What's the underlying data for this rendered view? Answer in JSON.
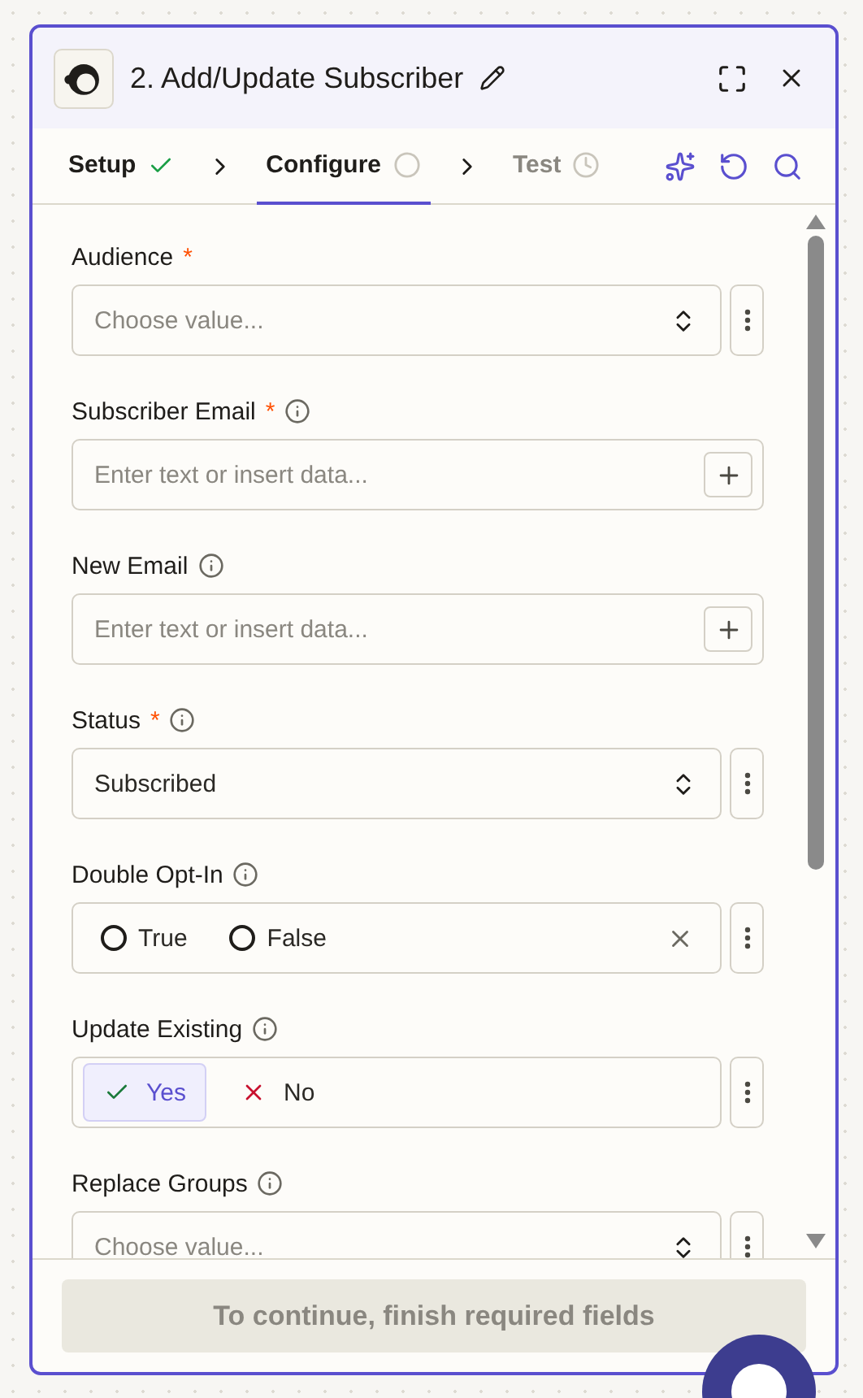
{
  "header": {
    "title": "2. Add/Update Subscriber"
  },
  "tabs": [
    {
      "label": "Setup",
      "selected": false,
      "done": true,
      "disabled": false
    },
    {
      "label": "Configure",
      "selected": true,
      "done": false,
      "disabled": false
    },
    {
      "label": "Test",
      "selected": false,
      "done": false,
      "disabled": true
    }
  ],
  "fields": [
    {
      "kind": "select",
      "label": "Audience",
      "required_mark": "*",
      "info": false,
      "placeholder": "Choose value..."
    },
    {
      "kind": "text",
      "label": "Subscriber Email",
      "required_mark": "*",
      "info": true,
      "placeholder": "Enter text or insert data..."
    },
    {
      "kind": "text",
      "label": "New Email",
      "info": true,
      "placeholder": "Enter text or insert data..."
    },
    {
      "kind": "select",
      "label": "Status",
      "required_mark": "*",
      "info": true,
      "value": "Subscribed"
    },
    {
      "kind": "radio",
      "label": "Double Opt-In",
      "info": true,
      "options": [
        {
          "label": "True",
          "selected": false
        },
        {
          "label": "False",
          "selected": false
        }
      ]
    },
    {
      "kind": "toggle",
      "label": "Update Existing",
      "info": true,
      "options": [
        {
          "label": "Yes",
          "selected": true
        },
        {
          "label": "No",
          "selected": false
        }
      ]
    },
    {
      "kind": "select",
      "label": "Replace Groups",
      "info": true,
      "placeholder": "Choose value..."
    }
  ],
  "footer": {
    "button": "To continue, finish required fields",
    "disabled": true
  }
}
